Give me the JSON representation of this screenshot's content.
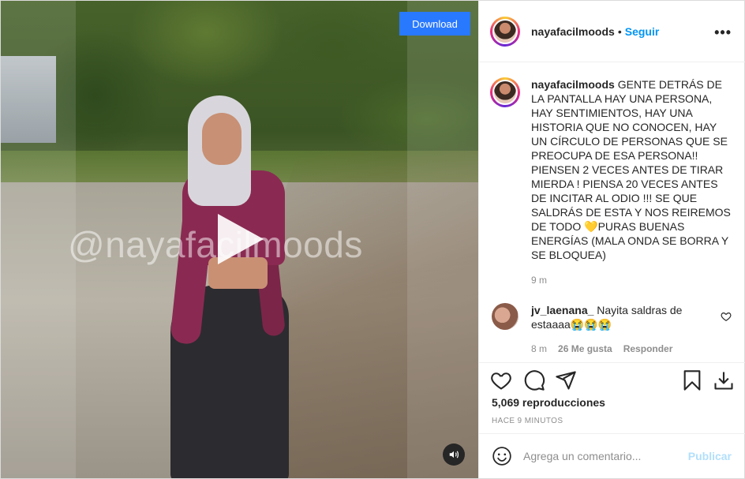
{
  "media": {
    "watermark": "@nayafacilmoods",
    "download_label": "Download",
    "play_icon": "play-icon",
    "sound_icon": "speaker-icon"
  },
  "header": {
    "username": "nayafacilmoods",
    "separator": "•",
    "follow_label": "Seguir",
    "more_icon": "more-options-icon"
  },
  "caption": {
    "username": "nayafacilmoods",
    "text": " GENTE DETRÁS DE LA PANTALLA HAY UNA PERSONA, HAY SENTIMIENTOS, HAY UNA HISTORIA QUE NO CONOCEN, HAY UN CÍRCULO DE PERSONAS QUE SE PREOCUPA DE ESA PERSONA!! PIENSEN 2 VECES ANTES DE TIRAR MIERDA ! PIENSA 20 VECES ANTES DE INCITAR AL ODIO !!! SE QUE SALDRÁS DE ESTA Y NOS REIREMOS DE TODO 💛PURAS BUENAS ENERGÍAS (MALA ONDA SE BORRA Y SE BLOQUEA)",
    "time": "9 m"
  },
  "comments": [
    {
      "username": "jv_laenana_",
      "text": " Nayita saldras de estaaaa😭😭😭",
      "time": "8 m",
      "likes": "26 Me gusta",
      "reply_label": "Responder"
    }
  ],
  "actions": {
    "icons": [
      "heart-icon",
      "comment-icon",
      "share-icon",
      "bookmark-icon",
      "download-icon"
    ],
    "views": "5,069 reproducciones",
    "time_ago": "HACE 9 MINUTOS"
  },
  "add_comment": {
    "placeholder": "Agrega un comentario...",
    "publish_label": "Publicar",
    "emoji_icon": "emoji-icon"
  },
  "colors": {
    "accent": "#0095f6",
    "download_button": "#2979ff",
    "publish_disabled": "#b2dffc",
    "muted_text": "#8e8e8e"
  }
}
